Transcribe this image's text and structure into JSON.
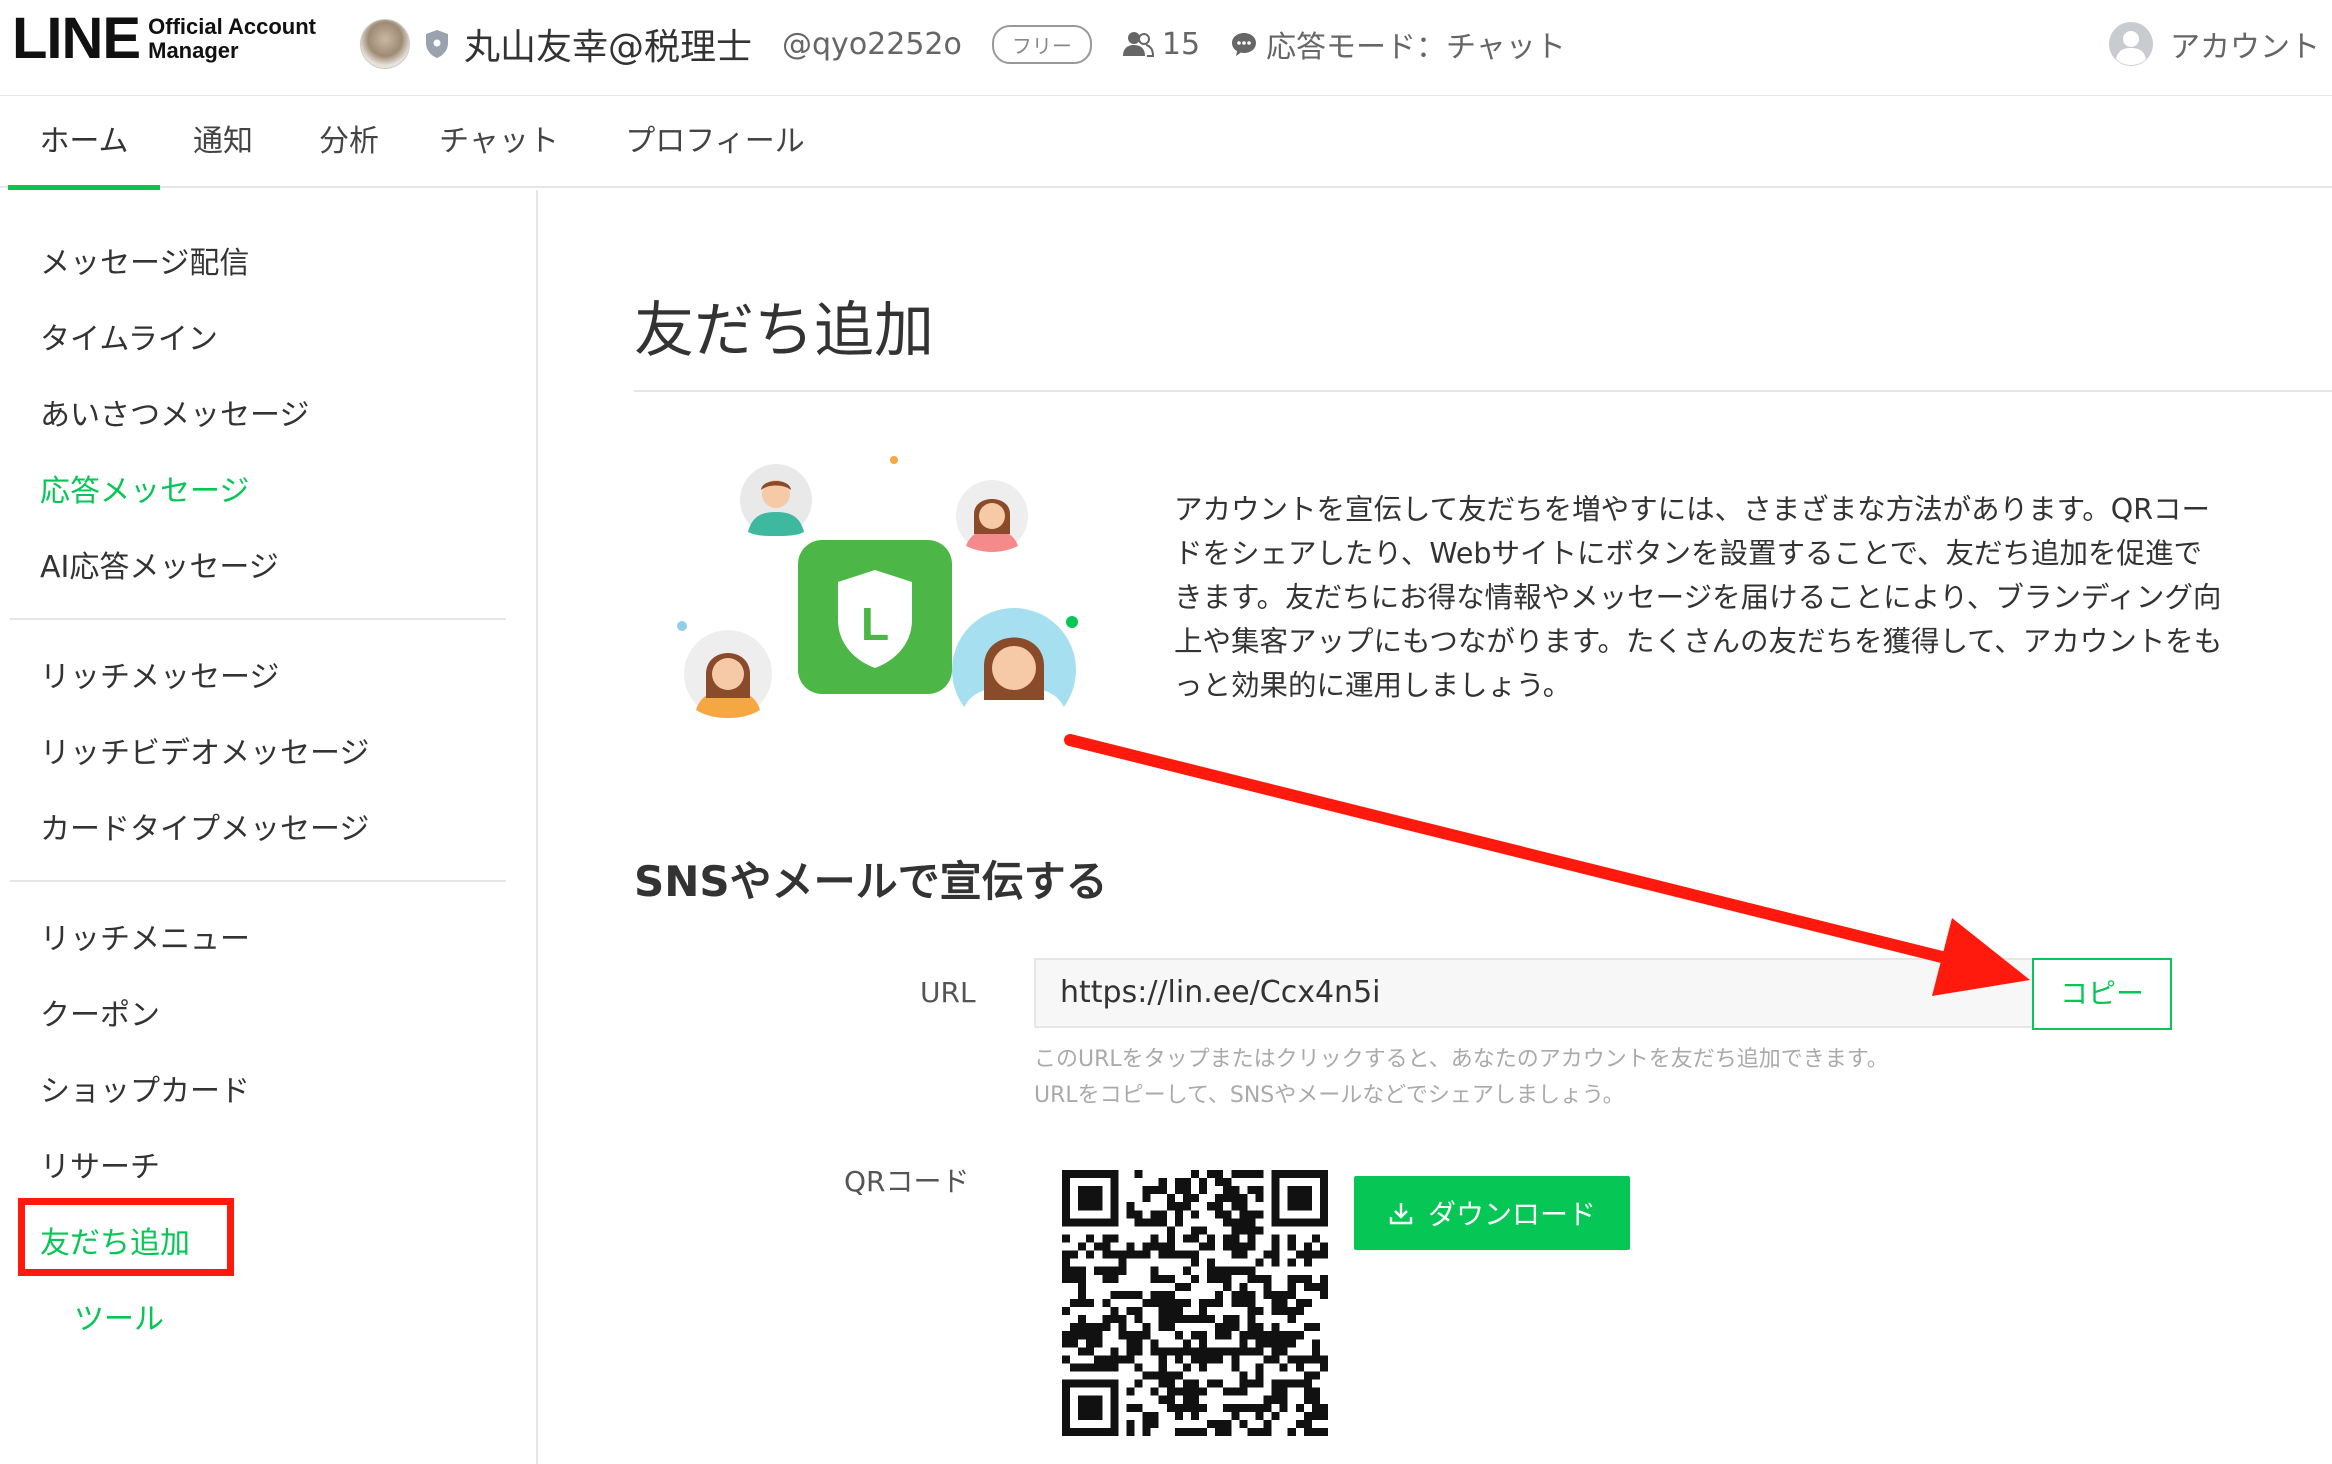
{
  "header": {
    "logo": {
      "main": "LINE",
      "sub_line1": "Official Account",
      "sub_line2": "Manager"
    },
    "account_name": "丸山友幸@税理士",
    "account_id": "@qyo2252o",
    "plan": "フリー",
    "friends_count": "15",
    "response_mode": "応答モード：チャット",
    "account_menu": "アカウント"
  },
  "tabs": [
    {
      "label": "ホーム",
      "active": true
    },
    {
      "label": "通知"
    },
    {
      "label": "分析"
    },
    {
      "label": "チャット"
    },
    {
      "label": "プロフィール"
    }
  ],
  "sidebar": {
    "group1": [
      "メッセージ配信",
      "タイムライン",
      "あいさつメッセージ",
      "応答メッセージ",
      "AI応答メッセージ"
    ],
    "group2": [
      "リッチメッセージ",
      "リッチビデオメッセージ",
      "カードタイプメッセージ"
    ],
    "group3": [
      "リッチメニュー",
      "クーポン",
      "ショップカード",
      "リサーチ",
      "友だち追加",
      "ツール"
    ]
  },
  "main": {
    "title": "友だち追加",
    "intro": "アカウントを宣伝して友だちを増やすには、さまざまな方法があります。QRコードをシェアしたり、Webサイトにボタンを設置することで、友だち追加を促進できます。友だちにお得な情報やメッセージを届けることにより、ブランディング向上や集客アップにもつながります。たくさんの友だちを獲得して、アカウントをもっと効果的に運用しましょう。",
    "illustration_letter": "L",
    "sns_section": {
      "title": "SNSやメールで宣伝する",
      "url_label": "URL",
      "url_value": "https://lin.ee/Ccx4n5i",
      "copy_label": "コピー",
      "help_line1": "このURLをタップまたはクリックすると、あなたのアカウントを友だち追加できます。",
      "help_line2": "URLをコピーして、SNSやメールなどでシェアしましょう。"
    },
    "qr_section": {
      "label": "QRコード",
      "download_label": "ダウンロード"
    }
  },
  "colors": {
    "brand_green": "#06c755",
    "annotation_red": "#ff1a0d"
  }
}
